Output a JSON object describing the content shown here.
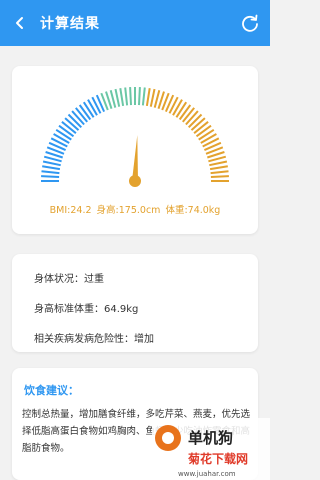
{
  "header": {
    "title": "计算结果"
  },
  "gauge": {
    "bmi_label": "BMI:24.2",
    "height_label": "身高:175.0cm",
    "weight_label": "体重:74.0kg",
    "bmi_value": 24.2,
    "colors": [
      "#2f97f1",
      "#6bc7a5",
      "#e3a22e"
    ]
  },
  "info": {
    "status": "身体状况：过重",
    "standard_weight": "身高标准体重：64.9kg",
    "disease_risk": "相关疾病发病危险性：增加"
  },
  "advice": {
    "title": "饮食建议：",
    "text": "控制总热量，增加膳食纤维，多吃芹菜、燕麦，优先选择低脂高蛋白食物如鸡胸肉、鱼虾，少吃油炸零食和高脂肪食物。"
  },
  "watermark": {
    "line1": "单机狗",
    "line2": "菊花下载网",
    "url": "www.juahar.com"
  }
}
